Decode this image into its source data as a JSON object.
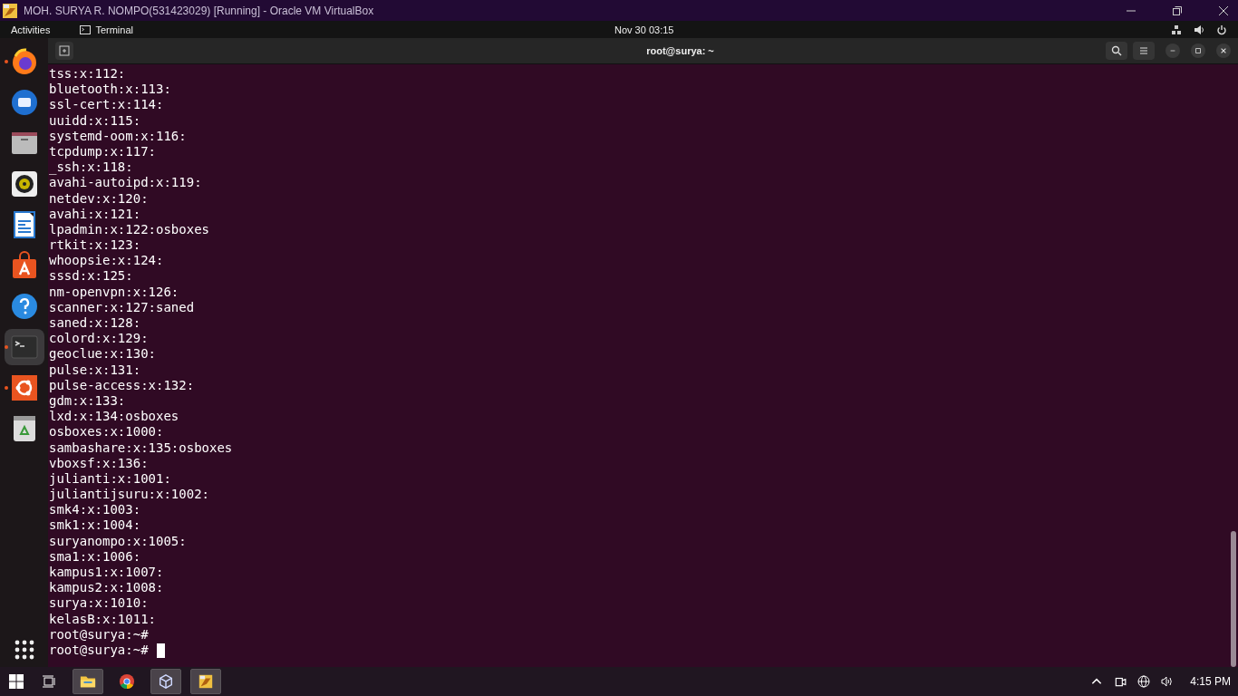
{
  "host_window": {
    "title": "MOH. SURYA R. NOMPO(531423029) [Running] - Oracle VM VirtualBox"
  },
  "top_bar": {
    "activities": "Activities",
    "app_name": "Terminal",
    "clock": "Nov 30  03:15"
  },
  "dock": [
    {
      "kind": "firefox",
      "running": true,
      "selected": false
    },
    {
      "kind": "mail",
      "running": false,
      "selected": false
    },
    {
      "kind": "files",
      "running": false,
      "selected": false
    },
    {
      "kind": "music",
      "running": false,
      "selected": false
    },
    {
      "kind": "writer",
      "running": false,
      "selected": false
    },
    {
      "kind": "store",
      "running": false,
      "selected": false
    },
    {
      "kind": "help",
      "running": false,
      "selected": false
    },
    {
      "kind": "terminal",
      "running": true,
      "selected": true
    },
    {
      "kind": "installer",
      "running": true,
      "selected": false
    },
    {
      "kind": "trash",
      "running": false,
      "selected": false
    }
  ],
  "terminal": {
    "title": "root@surya: ~",
    "lines": [
      "tss:x:112:",
      "bluetooth:x:113:",
      "ssl-cert:x:114:",
      "uuidd:x:115:",
      "systemd-oom:x:116:",
      "tcpdump:x:117:",
      "_ssh:x:118:",
      "avahi-autoipd:x:119:",
      "netdev:x:120:",
      "avahi:x:121:",
      "lpadmin:x:122:osboxes",
      "rtkit:x:123:",
      "whoopsie:x:124:",
      "sssd:x:125:",
      "nm-openvpn:x:126:",
      "scanner:x:127:saned",
      "saned:x:128:",
      "colord:x:129:",
      "geoclue:x:130:",
      "pulse:x:131:",
      "pulse-access:x:132:",
      "gdm:x:133:",
      "lxd:x:134:osboxes",
      "osboxes:x:1000:",
      "sambashare:x:135:osboxes",
      "vboxsf:x:136:",
      "julianti:x:1001:",
      "juliantijsuru:x:1002:",
      "smk4:x:1003:",
      "smk1:x:1004:",
      "suryanompo:x:1005:",
      "sma1:x:1006:",
      "kampus1:x:1007:",
      "kampus2:x:1008:",
      "surya:x:1010:",
      "kelasB:x:1011:",
      "root@surya:~#",
      "root@surya:~#"
    ]
  },
  "taskbar": {
    "items": [
      {
        "kind": "explorer",
        "active": true
      },
      {
        "kind": "chrome",
        "active": false
      },
      {
        "kind": "virtualbox",
        "active": true
      },
      {
        "kind": "vm",
        "active": true
      }
    ],
    "clock": "4:15 PM"
  }
}
